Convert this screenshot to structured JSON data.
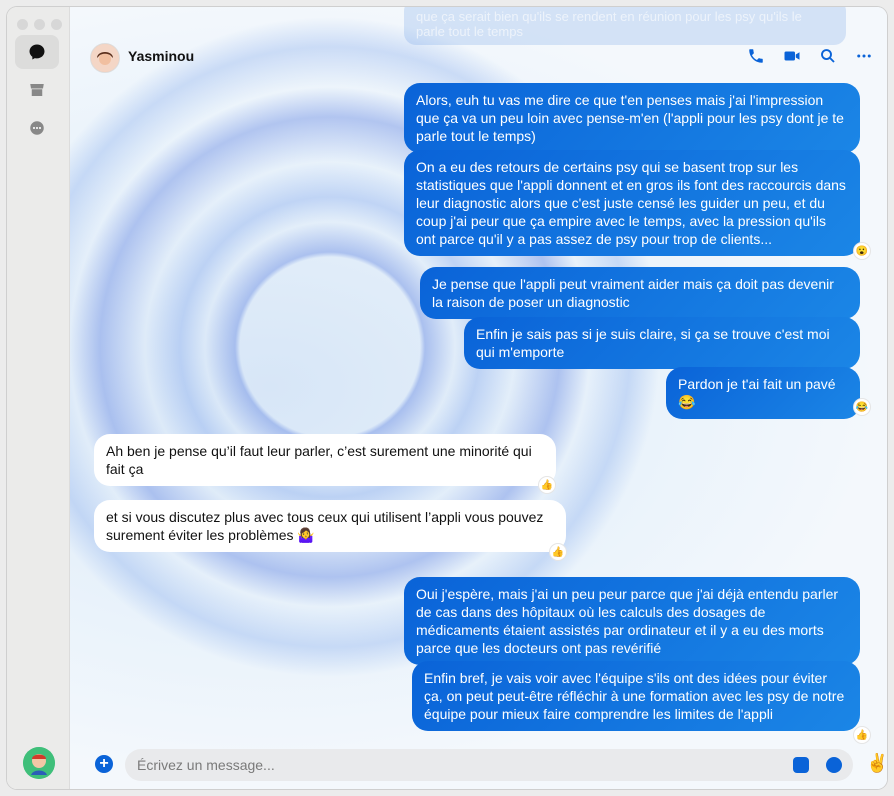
{
  "contact": {
    "name": "Yasminou"
  },
  "top_fragment": "que ça serait bien qu'ils se rendent en réunion pour les psy qu'ils le parle tout le temps",
  "messages": [
    {
      "text": "Alors, euh tu vas me dire ce que t'en penses mais j'ai l'impression que ça va un peu loin avec pense-m'en (l'appli pour les psy dont je te parle tout le temps)",
      "from": "me"
    },
    {
      "text": "On a eu des retours de certains psy qui se basent trop sur les statistiques que l'appli donnent et en gros ils font des raccourcis dans leur diagnostic alors que c'est juste censé les guider un peu, et du coup j'ai peur que ça empire avec le temps, avec la pression qu'ils ont parce qu'il y a pas assez de psy pour trop de clients...",
      "from": "me",
      "reaction": "😮"
    },
    {
      "text": "Je pense que l'appli peut vraiment aider mais ça doit pas devenir la raison de poser un diagnostic",
      "from": "me"
    },
    {
      "text": "Enfin je sais pas si je suis claire, si ça se trouve c'est moi qui m'emporte",
      "from": "me"
    },
    {
      "text": "Pardon je t'ai fait un pavé 😂",
      "from": "me",
      "reaction": "😂"
    },
    {
      "text": "Ah ben je pense qu’il faut leur parler, c’est surement une minorité qui fait ça",
      "from": "them",
      "reaction": "👍"
    },
    {
      "text": "et si vous discutez plus avec tous ceux qui utilisent l’appli vous pouvez surement éviter les problèmes 🤷‍♀️",
      "from": "them",
      "reaction": "👍"
    },
    {
      "text": "Oui j'espère, mais j'ai un peu peur parce que j'ai déjà entendu parler de cas dans des hôpitaux où les calculs des dosages de médicaments étaient assistés par ordinateur et il y a eu des morts parce que les docteurs ont pas revérifié",
      "from": "me"
    },
    {
      "text": "Enfin bref, je vais voir avec l'équipe s'ils ont des idées pour éviter ça, on peut peut-être réfléchir à une formation avec les psy de notre équipe pour mieux faire comprendre les limites de l'appli",
      "from": "me",
      "reaction": "👍"
    }
  ],
  "composer": {
    "placeholder": "Écrivez un message...",
    "quick_reaction": "✌️"
  },
  "icons": {
    "chat": "chat-bubble-icon",
    "marketplace": "store-icon",
    "requests": "message-requests-icon",
    "phone": "phone-icon",
    "video": "video-camera-icon",
    "search": "search-icon",
    "more": "more-icon"
  },
  "colors": {
    "accent": "#0a63d8"
  }
}
